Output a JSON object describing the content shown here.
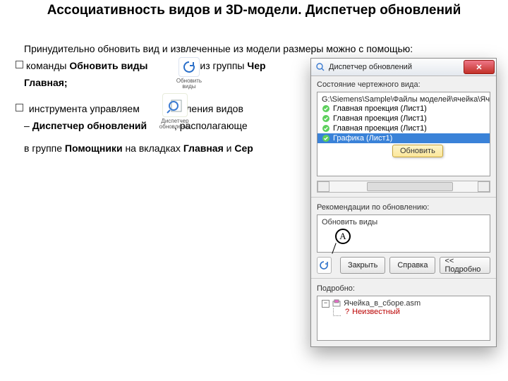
{
  "title": "Ассоциативность видов и 3D-модели. Диспетчер обновлений",
  "body": {
    "intro": "Принудительно обновить вид и извлеченные из модели размеры можно с помощью:",
    "b1_a": "команды ",
    "b1_b": "Обновить виды",
    "b1_c": " из группы ",
    "b1_d": "Чер",
    "b1_tab": "Главная;",
    "b2": " инструмента управляем           новления видов",
    "b2a": "– ",
    "b2b": "Диспетчер обновлений",
    "b2c": "          , располагающе",
    "b3a": "в группе ",
    "b3b": "Помощники",
    "b3c": " на вкладках ",
    "b3d": "Главная",
    "b3e": " и ",
    "b3f": "Сер"
  },
  "ribbon": {
    "icon1_l1": "Обновить",
    "icon1_l2": "виды",
    "icon2_l1": "Диспетчер",
    "icon2_l2": "обновлений"
  },
  "dlg": {
    "title": "Диспетчер обновлений",
    "grp_state": "Состояние чертежного вида:",
    "path": "G:\\Siemens\\Sample\\Файлы моделей\\ячейка\\Ячейка_в_сборе",
    "rows": [
      "Главная проекция (Лист1)",
      "Главная проекция (Лист1)",
      "Главная проекция (Лист1)",
      "Графика (Лист1)"
    ],
    "ctx": "Обновить",
    "grp_rec": "Рекомендации по обновлению:",
    "rec_text": "Обновить виды",
    "btn_close": "Закрыть",
    "btn_help": "Справка",
    "btn_more": "<<  Подробно",
    "grp_more": "Подробно:",
    "tree_root": "Ячейка_в_сборе.asm",
    "tree_child": "Неизвестный",
    "callout": "A"
  }
}
